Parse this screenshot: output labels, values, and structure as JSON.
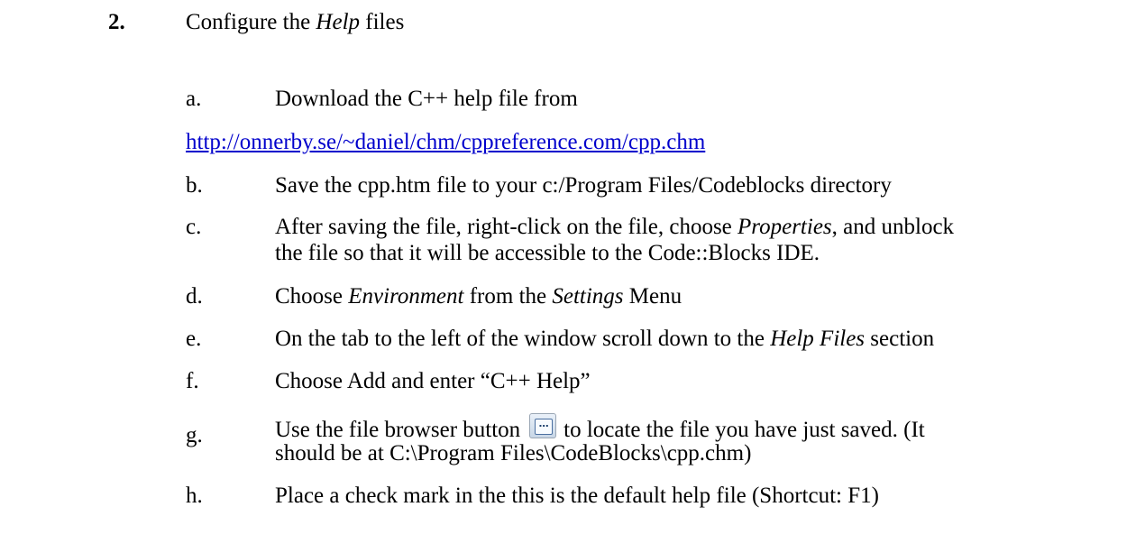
{
  "step": {
    "number": "2.",
    "title_pre": "Configure the ",
    "title_em": "Help",
    "title_post": " files"
  },
  "items": [
    {
      "letter": "a.",
      "line1": "Download the C++ help file from"
    },
    {
      "link": "http://onnerby.se/~daniel/chm/cppreference.com/cpp.chm"
    },
    {
      "letter": "b.",
      "line1": "Save the cpp.htm file to your c:/Program Files/Codeblocks directory"
    },
    {
      "letter": "c.",
      "line1_pre": "After saving the file, right-click on the file, choose ",
      "line1_em": "Properties",
      "line1_post": ", and unblock",
      "line2": "the file so that it will be accessible to the Code::Blocks IDE."
    },
    {
      "letter": "d.",
      "pre": "Choose ",
      "em1": "Environment",
      "mid": " from the ",
      "em2": "Settings",
      "post": " Menu"
    },
    {
      "letter": "e.",
      "pre": "On the tab to the left of the window scroll down to the ",
      "em": "Help Files",
      "post": " section"
    },
    {
      "letter": "f.",
      "line1": "Choose Add and enter “C++ Help”"
    },
    {
      "letter": "g.",
      "pre": "Use the file browser button",
      "button_icon": "ellipsis-browse-icon",
      "button_glyph": "…",
      "post": "to locate the file you have just saved. (It",
      "line2": "should be at C:\\Program Files\\CodeBlocks\\cpp.chm)"
    },
    {
      "letter": "h.",
      "line1": "Place a check mark in the this is the default help file (Shortcut: F1)"
    }
  ]
}
